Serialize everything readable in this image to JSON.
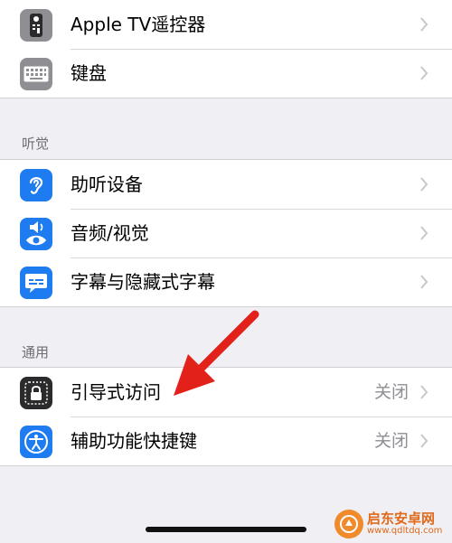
{
  "rows": {
    "apple_tv_remote": {
      "label": "Apple TV遥控器",
      "icon": "remote-control-icon"
    },
    "keyboard": {
      "label": "键盘",
      "icon": "keyboard-icon"
    },
    "hearing_devices": {
      "label": "助听设备",
      "icon": "ear-icon"
    },
    "audio_visual": {
      "label": "音频/视觉",
      "icon": "speaker-eye-icon"
    },
    "subtitles": {
      "label": "字幕与隐藏式字幕",
      "icon": "subtitles-icon"
    },
    "guided_access": {
      "label": "引导式访问",
      "value": "关闭",
      "icon": "lock-icon"
    },
    "accessibility_shortcut": {
      "label": "辅助功能快捷键",
      "value": "关闭",
      "icon": "accessibility-icon"
    }
  },
  "sections": {
    "hearing": {
      "title": "听觉"
    },
    "general": {
      "title": "通用"
    }
  },
  "watermark": {
    "title": "启东安卓网",
    "url": "www.qdltdq.com"
  },
  "colors": {
    "background": "#efeff4",
    "icon_blue": "#1e7cf0",
    "icon_gray": "#8e8e93",
    "icon_dark": "#2b2b2d",
    "arrow_red": "#e3211b",
    "watermark_orange": "#f08a2a"
  }
}
